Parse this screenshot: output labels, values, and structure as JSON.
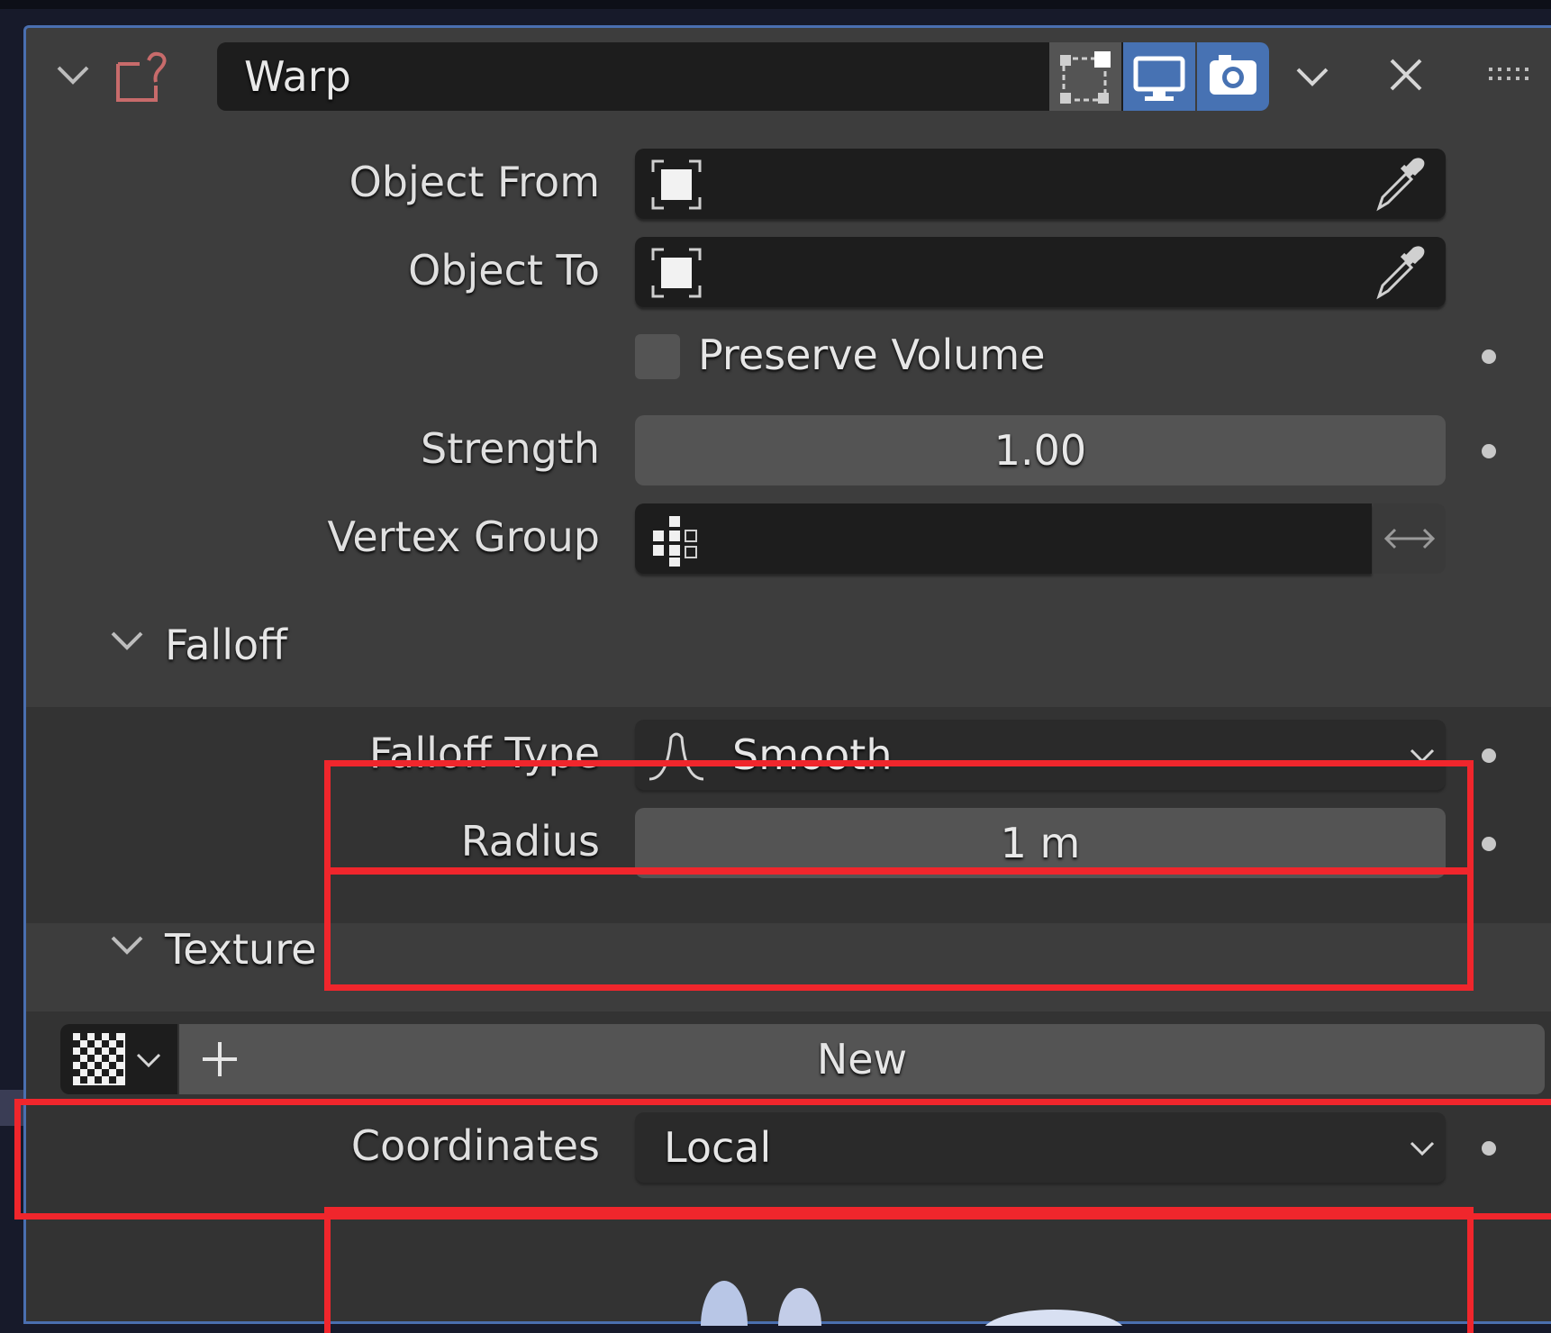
{
  "modifier": {
    "name": "Warp",
    "toggle_icons": [
      "edit-mode-icon",
      "viewport-icon",
      "render-icon"
    ]
  },
  "fields": {
    "object_from_label": "Object From",
    "object_to_label": "Object To",
    "preserve_volume_label": "Preserve Volume",
    "preserve_volume_checked": false,
    "strength_label": "Strength",
    "strength_value": "1.00",
    "vertex_group_label": "Vertex Group"
  },
  "falloff": {
    "title": "Falloff",
    "type_label": "Falloff Type",
    "type_value": "Smooth",
    "radius_label": "Radius",
    "radius_value": "1 m"
  },
  "texture": {
    "title": "Texture",
    "new_label": "New",
    "coordinates_label": "Coordinates",
    "coordinates_value": "Local"
  },
  "colors": {
    "accent_blue": "#4772b3",
    "highlight_red": "#f0262c",
    "panel_bg": "#3d3d3d",
    "field_bg": "#1d1d1d"
  }
}
